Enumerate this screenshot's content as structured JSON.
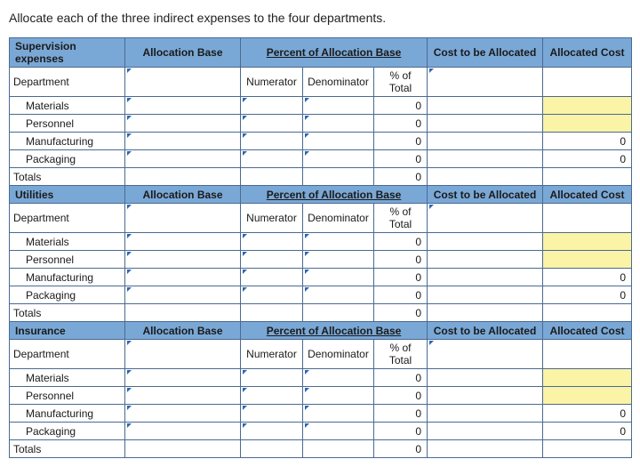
{
  "instruction": "Allocate each of the three indirect expenses to the four departments.",
  "cols": {
    "alloc_base": "Allocation Base",
    "pct_base": "Percent of Allocation Base",
    "cost_alloc": "Cost to be Allocated",
    "allocated": "Allocated Cost",
    "numerator": "Numerator",
    "denominator": "Denominator",
    "pct_total": "% of Total"
  },
  "labels": {
    "department": "Department",
    "totals": "Totals"
  },
  "sections": [
    {
      "title": "Supervision expenses"
    },
    {
      "title": "Utilities"
    },
    {
      "title": "Insurance"
    }
  ],
  "rows": {
    "materials": "Materials",
    "personnel": "Personnel",
    "manufacturing": "Manufacturing",
    "packaging": "Packaging"
  },
  "values": {
    "zero": "0"
  }
}
